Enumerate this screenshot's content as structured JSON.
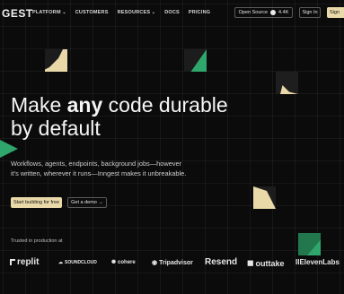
{
  "brand": {
    "logo_text": "GEST"
  },
  "nav": {
    "items": [
      {
        "label": "PLATFORM",
        "dropdown": true
      },
      {
        "label": "CUSTOMERS",
        "dropdown": false
      },
      {
        "label": "RESOURCES",
        "dropdown": true
      },
      {
        "label": "DOCS",
        "dropdown": false
      },
      {
        "label": "PRICING",
        "dropdown": false
      }
    ],
    "open_source_label": "Open Source",
    "stars": "4.4K",
    "sign_in": "Sign In",
    "sign_up": "Sign"
  },
  "hero": {
    "headline_pre": "Make ",
    "headline_em": "any",
    "headline_post": " code durable by default",
    "subtitle": "Workflows, agents, endpoints, background jobs—however it's written, wherever it runs—Inngest makes it unbreakable.",
    "primary_cta": "Start building for free",
    "secondary_cta": "Get a demo →"
  },
  "trusted": {
    "label": "Trusted in production at",
    "logos": [
      "replit",
      "SOUNDCLOUD",
      "cohere",
      "Tripadvisor",
      "Resend",
      "outtake",
      "IIElevenLabs"
    ]
  },
  "colors": {
    "accent": "#e9d9a9",
    "green": "#2fa66b",
    "background": "#0b0b0b"
  }
}
